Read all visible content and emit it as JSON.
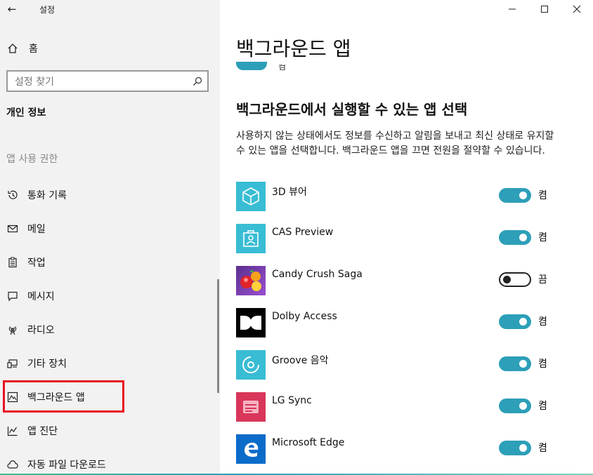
{
  "window": {
    "title": "설정",
    "back_icon": "back-arrow-icon",
    "controls": {
      "minimize": "—",
      "maximize": "☐",
      "close": "✕"
    }
  },
  "sidebar": {
    "home_label": "홈",
    "search_placeholder": "설정 찾기",
    "section_title": "개인 정보",
    "group_label": "앱 사용 권한",
    "items": [
      {
        "label": "통화 기록",
        "icon": "history-icon"
      },
      {
        "label": "메일",
        "icon": "mail-icon"
      },
      {
        "label": "작업",
        "icon": "clipboard-icon"
      },
      {
        "label": "메시지",
        "icon": "message-icon"
      },
      {
        "label": "라디오",
        "icon": "radio-icon"
      },
      {
        "label": "기타 장치",
        "icon": "device-icon"
      },
      {
        "label": "백그라운드 앱",
        "icon": "background-app-icon"
      },
      {
        "label": "앱 진단",
        "icon": "diagnostics-icon"
      },
      {
        "label": "자동 파일 다운로드",
        "icon": "cloud-icon"
      }
    ],
    "active_item": "백그라운드 앱"
  },
  "main": {
    "page_title": "백그라운드 앱",
    "partial_char": "켬",
    "sub_heading": "백그라운드에서 실행할 수 있는 앱 선택",
    "description": "사용하지 않는 상태에서도 정보를 수신하고 알림을 보내고 최신 상태로 유지할 수 있는 앱을 선택합니다. 백그라운드 앱을 끄면 전원을 절약할 수 있습니다.",
    "apps": [
      {
        "name": "3D 뷰어",
        "state": "켬",
        "on": true,
        "icon": "3d-viewer-icon",
        "tile_color": "#38bdd4"
      },
      {
        "name": "CAS Preview",
        "state": "켬",
        "on": true,
        "icon": "cas-preview-icon",
        "tile_color": "#38bdd4"
      },
      {
        "name": "Candy Crush Saga",
        "state": "끔",
        "on": false,
        "icon": "candy-crush-icon",
        "tile_color": "#6b3aa3"
      },
      {
        "name": "Dolby Access",
        "state": "켬",
        "on": true,
        "icon": "dolby-icon",
        "tile_color": "#000000"
      },
      {
        "name": "Groove 음악",
        "state": "켬",
        "on": true,
        "icon": "groove-music-icon",
        "tile_color": "#38bdd4"
      },
      {
        "name": "LG Sync",
        "state": "켬",
        "on": true,
        "icon": "lg-sync-icon",
        "tile_color": "#d8365a"
      },
      {
        "name": "Microsoft Edge",
        "state": "켬",
        "on": true,
        "icon": "edge-icon",
        "tile_color": "#0a6bc9"
      }
    ]
  },
  "colors": {
    "accent": "#2d9fb8",
    "highlight": "#e81123",
    "sidebar_bg": "#f2f2f2"
  }
}
